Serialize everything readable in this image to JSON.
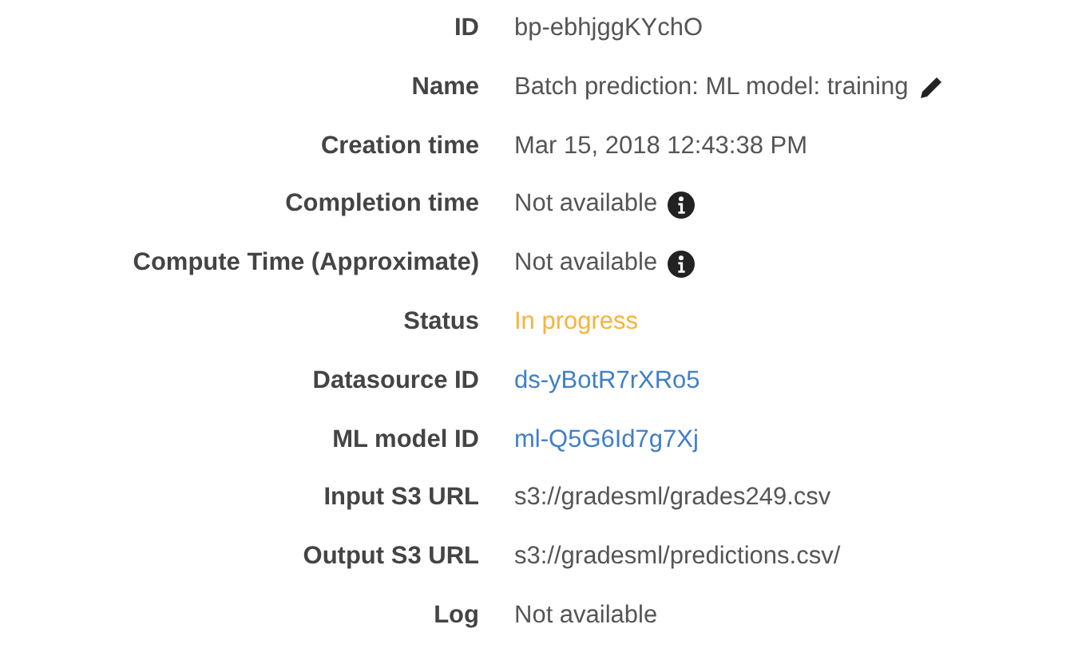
{
  "details": [
    {
      "label": "ID",
      "value": "bp-ebhjggKYchO",
      "kind": "text"
    },
    {
      "label": "Name",
      "value": "Batch prediction: ML model: training",
      "kind": "editable"
    },
    {
      "label": "Creation time",
      "value": "Mar 15, 2018 12:43:38 PM",
      "kind": "text"
    },
    {
      "label": "Completion time",
      "value": "Not available",
      "kind": "info"
    },
    {
      "label": "Compute Time (Approximate)",
      "value": "Not available",
      "kind": "info"
    },
    {
      "label": "Status",
      "value": "In progress",
      "kind": "status"
    },
    {
      "label": "Datasource ID",
      "value": "ds-yBotR7rXRo5",
      "kind": "link"
    },
    {
      "label": "ML model ID",
      "value": "ml-Q5G6Id7g7Xj",
      "kind": "link"
    },
    {
      "label": "Input S3 URL",
      "value": "s3://gradesml/grades249.csv",
      "kind": "text"
    },
    {
      "label": "Output S3 URL",
      "value": "s3://gradesml/predictions.csv/",
      "kind": "text"
    },
    {
      "label": "Log",
      "value": "Not available",
      "kind": "text"
    }
  ]
}
